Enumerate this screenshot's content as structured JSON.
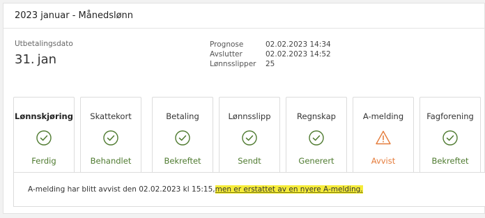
{
  "header": {
    "title": "2023 januar - Månedslønn"
  },
  "summary": {
    "label": "Utbetalingsdato",
    "day": "31.",
    "month": "jan"
  },
  "meta": [
    {
      "key": "Prognose",
      "value": "02.02.2023 14:34"
    },
    {
      "key": "Avslutter",
      "value": "02.02.2023 14:52"
    },
    {
      "key": "Lønnsslipper",
      "value": "25"
    }
  ],
  "tabs": [
    {
      "title": "Lønnskjøring",
      "status": "Ferdig",
      "icon": "check-circle-icon",
      "state": "ok"
    },
    {
      "title": "Skattekort",
      "status": "Behandlet",
      "icon": "check-circle-icon",
      "state": "ok"
    },
    {
      "title": "Betaling",
      "status": "Bekreftet",
      "icon": "check-circle-icon",
      "state": "ok"
    },
    {
      "title": "Lønnsslipp",
      "status": "Sendt",
      "icon": "check-circle-icon",
      "state": "ok"
    },
    {
      "title": "Regnskap",
      "status": "Generert",
      "icon": "check-circle-icon",
      "state": "ok"
    },
    {
      "title": "A-melding",
      "status": "Avvist",
      "icon": "warning-triangle-icon",
      "state": "warn"
    },
    {
      "title": "Fagforening",
      "status": "Bekreftet",
      "icon": "check-circle-icon",
      "state": "ok"
    }
  ],
  "message": {
    "text": "A-melding har blitt avvist den 02.02.2023 kl 15:15, ",
    "highlight": "men er erstattet av en nyere A-melding."
  },
  "colors": {
    "ok": "#4e7a2f",
    "warn": "#e57c3b",
    "highlight": "#f6ec3a"
  }
}
